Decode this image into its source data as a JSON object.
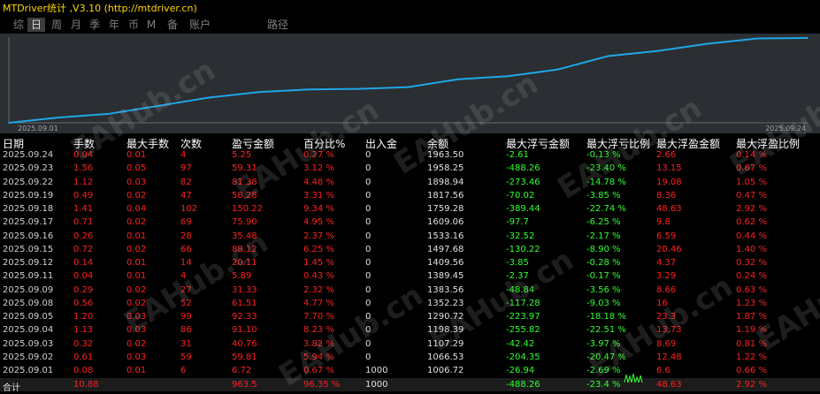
{
  "title": "MTDriver统计 ,V3.10 (http://mtdriver.cn)",
  "tabs": [
    {
      "label": "综",
      "active": false
    },
    {
      "label": "日",
      "active": true
    },
    {
      "label": "周",
      "active": false
    },
    {
      "label": "月",
      "active": false
    },
    {
      "label": "季",
      "active": false
    },
    {
      "label": "年",
      "active": false
    },
    {
      "label": "币",
      "active": false
    },
    {
      "label": "M",
      "active": false
    },
    {
      "label": "备",
      "active": false
    },
    {
      "label": "账户",
      "active": false
    },
    {
      "label": "路径",
      "active": false
    }
  ],
  "chart_data": {
    "type": "line",
    "x_start_label": "2025.09.01",
    "x_end_label": "2025.09.24",
    "x": [
      "2025.09.01",
      "2025.09.02",
      "2025.09.03",
      "2025.09.04",
      "2025.09.05",
      "2025.09.08",
      "2025.09.09",
      "2025.09.11",
      "2025.09.12",
      "2025.09.15",
      "2025.09.16",
      "2025.09.17",
      "2025.09.18",
      "2025.09.19",
      "2025.09.22",
      "2025.09.23",
      "2025.09.24"
    ],
    "values": [
      1006.72,
      1066.53,
      1107.29,
      1198.39,
      1290.72,
      1352.23,
      1383.56,
      1389.45,
      1409.56,
      1497.68,
      1533.16,
      1609.06,
      1759.28,
      1817.56,
      1898.94,
      1958.25,
      1963.5
    ],
    "line_color": "#1ea7e8"
  },
  "watermark": "EAHub.cn",
  "columns": [
    "日期",
    "手数",
    "最大手数",
    "次数",
    "盈亏金额",
    "百分比%",
    "出入金",
    "余额",
    "最大浮亏金额",
    "最大浮亏比例",
    "最大浮盈金额",
    "最大浮盈比例"
  ],
  "rows": [
    [
      "2025.09.24",
      "0.04",
      "0.01",
      "4",
      "5.25",
      "0.27 %",
      "0",
      "1963.50",
      "-2.61",
      "-0.13 %",
      "2.66",
      "0.14 %"
    ],
    [
      "2025.09.23",
      "1.56",
      "0.05",
      "97",
      "59.31",
      "3.12 %",
      "0",
      "1958.25",
      "-488.26",
      "-23.40 %",
      "13.15",
      "0.67 %"
    ],
    [
      "2025.09.22",
      "1.12",
      "0.03",
      "82",
      "81.38",
      "4.48 %",
      "0",
      "1898.94",
      "-273.46",
      "-14.78 %",
      "19.08",
      "1.05 %"
    ],
    [
      "2025.09.19",
      "0.49",
      "0.02",
      "47",
      "58.28",
      "3.31 %",
      "0",
      "1817.56",
      "-70.02",
      "-3.85 %",
      "8.36",
      "0.47 %"
    ],
    [
      "2025.09.18",
      "1.41",
      "0.04",
      "102",
      "150.22",
      "9.34 %",
      "0",
      "1759.28",
      "-389.44",
      "-22.74 %",
      "48.63",
      "2.92 %"
    ],
    [
      "2025.09.17",
      "0.71",
      "0.02",
      "69",
      "75.90",
      "4.95 %",
      "0",
      "1609.06",
      "-97.7",
      "-6.25 %",
      "9.8",
      "0.62 %"
    ],
    [
      "2025.09.16",
      "0.26",
      "0.01",
      "28",
      "35.48",
      "2.37 %",
      "0",
      "1533.16",
      "-32.52",
      "-2.17 %",
      "6.59",
      "0.44 %"
    ],
    [
      "2025.09.15",
      "0.72",
      "0.02",
      "66",
      "88.12",
      "6.25 %",
      "0",
      "1497.68",
      "-130.22",
      "-8.90 %",
      "20.46",
      "1.40 %"
    ],
    [
      "2025.09.12",
      "0.14",
      "0.01",
      "14",
      "20.11",
      "1.45 %",
      "0",
      "1409.56",
      "-3.85",
      "-0.28 %",
      "4.37",
      "0.32 %"
    ],
    [
      "2025.09.11",
      "0.04",
      "0.01",
      "4",
      "5.89",
      "0.43 %",
      "0",
      "1389.45",
      "-2.37",
      "-0.17 %",
      "3.29",
      "0.24 %"
    ],
    [
      "2025.09.09",
      "0.29",
      "0.02",
      "27",
      "31.33",
      "2.32 %",
      "0",
      "1383.56",
      "-48.84",
      "-3.56 %",
      "8.66",
      "0.63 %"
    ],
    [
      "2025.09.08",
      "0.56",
      "0.02",
      "52",
      "61.51",
      "4.77 %",
      "0",
      "1352.23",
      "-117.28",
      "-9.03 %",
      "16",
      "1.23 %"
    ],
    [
      "2025.09.05",
      "1.20",
      "0.03",
      "99",
      "92.33",
      "7.70 %",
      "0",
      "1290.72",
      "-223.97",
      "-18.18 %",
      "23.3",
      "1.87 %"
    ],
    [
      "2025.09.04",
      "1.13",
      "0.03",
      "86",
      "91.10",
      "8.23 %",
      "0",
      "1198.39",
      "-255.82",
      "-22.51 %",
      "13.73",
      "1.19 %"
    ],
    [
      "2025.09.03",
      "0.32",
      "0.02",
      "31",
      "40.76",
      "3.82 %",
      "0",
      "1107.29",
      "-42.42",
      "-3.97 %",
      "8.69",
      "0.81 %"
    ],
    [
      "2025.09.02",
      "0.61",
      "0.03",
      "59",
      "59.81",
      "5.94 %",
      "0",
      "1066.53",
      "-204.35",
      "-20.47 %",
      "12.48",
      "1.22 %"
    ],
    [
      "2025.09.01",
      "0.08",
      "0.01",
      "6",
      "6.72",
      "0.67 %",
      "1000",
      "1006.72",
      "-26.94",
      "-2.69 %",
      "6.6",
      "0.66 %"
    ]
  ],
  "total_row": [
    "合计",
    "10.88",
    "",
    "",
    "963.5",
    "96.35 %",
    "1000",
    "",
    "-488.26",
    "-23.4 %",
    "48.63",
    "2.92 %"
  ],
  "colors": {
    "title": "#ffd700",
    "profit": "#ff2020",
    "loss": "#30ff30",
    "text": "#e0e0e0",
    "chart_bg": "#2b2e32"
  }
}
